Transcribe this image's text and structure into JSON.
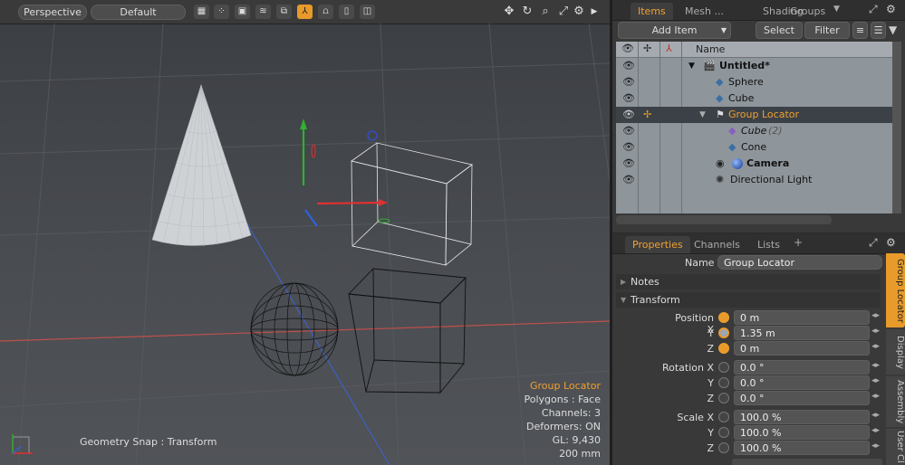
{
  "viewport": {
    "view_mode": "Perspective",
    "shading": "Default",
    "status": {
      "title": "Group Locator",
      "polygons": "Polygons : Face",
      "channels": "Channels: 3",
      "deformers": "Deformers: ON",
      "gl": "GL: 9,430",
      "scale": "200 mm"
    },
    "snap_text": "Geometry Snap : Transform",
    "toolbar_icons": [
      "grid-icon",
      "vertex-icon",
      "box-icon",
      "wave-icon",
      "layer-icon",
      "mesh-icon",
      "person-icon",
      "hand-icon",
      "cylinder-icon"
    ],
    "accent": "#e89a2a"
  },
  "items_panel": {
    "tabs": [
      "Items",
      "Mesh ...",
      "Shading",
      "Groups"
    ],
    "active_tab": "Items",
    "add_item": "Add Item",
    "select": "Select",
    "filter": "Filter",
    "name_header": "Name",
    "rows": [
      {
        "label": "Untitled*",
        "bold": true,
        "icon": "scene-icon"
      },
      {
        "label": "Sphere",
        "icon": "mesh-icon"
      },
      {
        "label": "Cube",
        "icon": "mesh-icon"
      },
      {
        "label": "Group Locator",
        "icon": "locator-icon",
        "selected": true
      },
      {
        "label": "Cube",
        "suffix": "(2)",
        "italic": true,
        "icon": "mesh-icon"
      },
      {
        "label": "Cone",
        "icon": "mesh-icon"
      },
      {
        "label": "Camera",
        "bold": true,
        "icon": "camera-icon"
      },
      {
        "label": "Directional Light",
        "icon": "light-icon"
      }
    ]
  },
  "properties_panel": {
    "tabs": [
      "Properties",
      "Channels",
      "Lists"
    ],
    "active_tab": "Properties",
    "name_label": "Name",
    "name_value": "Group Locator",
    "notes": "Notes",
    "transform": "Transform",
    "position_label": "Position X",
    "rotation_label": "Rotation X",
    "scale_label": "Scale X",
    "y_label": "Y",
    "z_label": "Z",
    "position": [
      "0 m",
      "1.35 m",
      "0 m"
    ],
    "rotation": [
      "0.0 °",
      "0.0 °",
      "0.0 °"
    ],
    "scale": [
      "100.0 %",
      "100.0 %",
      "100.0 %"
    ],
    "side_tabs": [
      "Group Locator",
      "Display",
      "Assembly",
      "User Cl"
    ]
  }
}
